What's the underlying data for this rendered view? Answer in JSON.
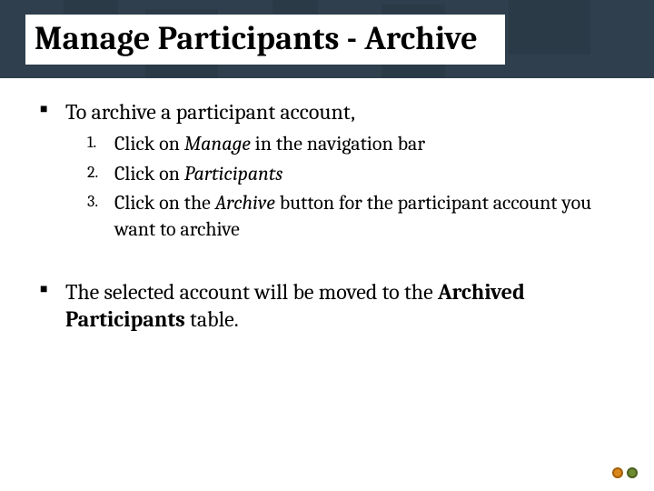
{
  "title": "Manage Participants - Archive",
  "bullets": {
    "intro": "To archive a participant account,",
    "steps": [
      {
        "pre": "Click on ",
        "em": "Manage",
        "post": " in the navigation bar",
        "style": "italic"
      },
      {
        "pre": "Click on ",
        "em": "Participants",
        "post": "",
        "style": "italic"
      },
      {
        "pre": "Click on the ",
        "em": "Archive",
        "post": " button for the participant account you want to archive",
        "style": "italic"
      }
    ],
    "result_pre": "The selected account will be moved to the ",
    "result_strong": "Archived Participants",
    "result_post": " table."
  },
  "icons": {
    "prev": "prev-slide-icon",
    "next": "next-slide-icon"
  }
}
